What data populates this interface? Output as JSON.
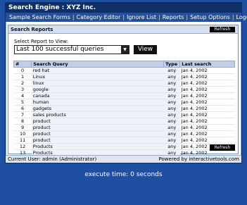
{
  "window": {
    "title": "Search Engine : XYZ Inc.",
    "menu": [
      "Sample Search Forms",
      "Category Editor",
      "Ignore List",
      "Reports",
      "Setup Options",
      "Logoff"
    ]
  },
  "panel": {
    "title": "Search Reports",
    "refresh_label": "Refresh",
    "select_label": "Select Report to View:",
    "selected_report": "Last 100 successful queries",
    "view_label": "View",
    "table": {
      "headers": [
        "#",
        "Search Query",
        "Type",
        "Last search"
      ],
      "rows": [
        [
          "0",
          "red hat",
          "any",
          "Jan 4, 2002"
        ],
        [
          "1",
          "Linux",
          "any",
          "Jan 4, 2002"
        ],
        [
          "2",
          "linux",
          "any",
          "Jan 4, 2002"
        ],
        [
          "3",
          "google",
          "any",
          "Jan 4, 2002"
        ],
        [
          "4",
          "canada",
          "any",
          "Jan 4, 2002"
        ],
        [
          "5",
          "human",
          "any",
          "Jan 4, 2002"
        ],
        [
          "6",
          "gadgets",
          "any",
          "Jan 4, 2002"
        ],
        [
          "7",
          "sales products",
          "any",
          "Jan 4, 2002"
        ],
        [
          "8",
          "product",
          "any",
          "Jan 4, 2002"
        ],
        [
          "9",
          "product",
          "any",
          "Jan 4, 2002"
        ],
        [
          "10",
          "product",
          "any",
          "Jan 4, 2002"
        ],
        [
          "11",
          "product",
          "any",
          "Jan 4, 2002"
        ],
        [
          "12",
          "Products",
          "any",
          "Jan 4, 2002"
        ],
        [
          "13",
          "Products",
          "any",
          "Jan 4, 2002"
        ]
      ]
    }
  },
  "status": {
    "user": "Current User: admin (Administrator)",
    "powered": "Powered by interactivetools.com"
  },
  "footer": {
    "exec_time": "execute time: 0 seconds"
  },
  "colors": {
    "background": "#1f4fa0",
    "titlebar": "#0f2f6a",
    "menubar": "#264f95"
  }
}
